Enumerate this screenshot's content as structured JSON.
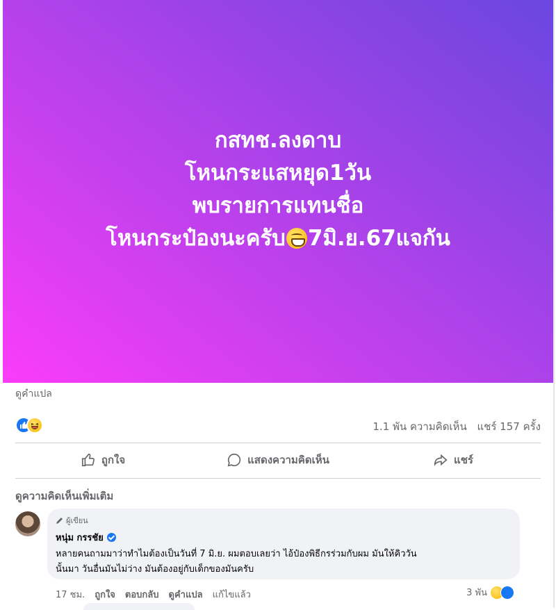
{
  "post": {
    "banner_lines": [
      "กสทช.ลงดาบ",
      "โหนกระแสหยุด1วัน",
      "พบรายการแทนชื่อ",
      "โหนกระป๋องนะครับ",
      "7มิ.ย.67แจกัน"
    ],
    "banner_emoji": "grinning-face-with-smiling-eyes",
    "gradient_colors": [
      "#fb3cfa",
      "#6a46e0"
    ],
    "see_translation": "ดูคำแปล",
    "comments_count": "1.1 พัน ความคิดเห็น",
    "shares_count": "แชร์ 157 ครั้ง",
    "reaction_icons": [
      "like-icon",
      "haha-icon"
    ]
  },
  "actions": {
    "like": "ถูกใจ",
    "comment": "แสดงความคิดเห็น",
    "share": "แชร์"
  },
  "more_comments": "ดูความคิดเห็นเพิ่มเติม",
  "comment": {
    "badge": "ผู้เขียน",
    "name": "หนุ่ม กรรชัย",
    "text_line1": "หลายคนถามมาว่าทำไมต้องเป็นวันที่ 7 มิ.ย. ผมตอบเลยว่า ไอ้ป๋องพิธีกรร่วมกับผม มันให้คิววัน",
    "text_line2": "นั้นมา วันอื่นมันไม่ว่าง มันต้องอยู่กับเด็กของมันครับ",
    "time": "17 ชม.",
    "like": "ถูกใจ",
    "reply": "ตอบกลับ",
    "translate": "ดูคำแปล",
    "edited": "แก้ไขแล้ว",
    "reaction_count": "3 พัน"
  },
  "colors": {
    "accent": "#1877f2",
    "muted_text": "#65676b",
    "bubble": "#f0f2f5"
  }
}
